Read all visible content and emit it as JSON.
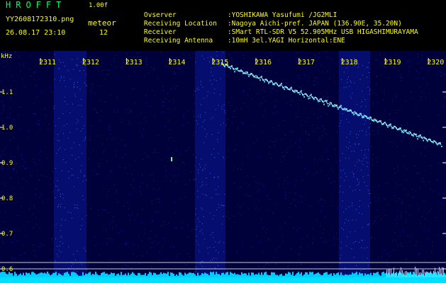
{
  "header": {
    "app_name": "HROFFT",
    "version": "1.00f",
    "filename": "YY2608172310.png",
    "datetime": "26.08.17 23:10",
    "meteor_label": "meteor",
    "meteor_count": "12"
  },
  "info": [
    {
      "key": "Ovserver",
      "value": ":YOSHIKAWA Yasufumi /JG2MLI"
    },
    {
      "key": "Receiving Location",
      "value": ":Nagoya Aichi-pref. JAPAN (136.90E, 35.20N)"
    },
    {
      "key": "Receiver",
      "value": ":SMart RTL-SDR V5 52.905MHz USB HIGASHIMURAYAMA"
    },
    {
      "key": "Receiving Antenna",
      "value": ":10mH 3el.YAGI Horizontal:ENE"
    }
  ],
  "spectrogram": {
    "y_unit": "kHz",
    "y_ticks": [
      "1.1",
      "1.0",
      "0.9",
      "0.8",
      "0.7",
      "0.6"
    ],
    "x_ticks": [
      "2311",
      "2312",
      "2313",
      "2314",
      "2315",
      "2316",
      "2317",
      "2318",
      "2319",
      "2320"
    ],
    "colors": {
      "background": "#00003a",
      "noise": "#1a3cff",
      "signal": "#55ddff",
      "text": "#ffff00"
    }
  }
}
